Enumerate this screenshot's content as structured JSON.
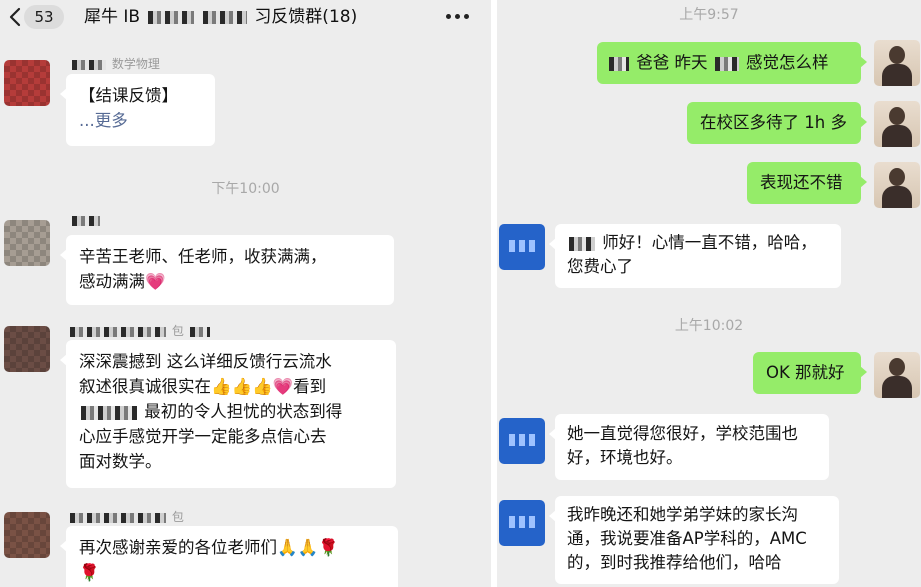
{
  "left_chat": {
    "back_icon": "chevron-left-icon",
    "unread_count": "53",
    "title_start": "犀牛 IB",
    "title_end": "习反馈群(18)",
    "more_icon": "ellipsis-icon",
    "messages": [
      {
        "sender": "数学物理",
        "lines": [
          "【结课反馈】"
        ],
        "more": "...更多"
      },
      {
        "timestamp": "下午10:00"
      },
      {
        "lines": [
          "辛苦王老师、任老师，收获满满，",
          "感动满满💗"
        ]
      },
      {
        "sender": "包",
        "lines": [
          "深深震撼到 这么详细反馈行云流水",
          "叙述很真诚很实在👍👍👍💗看到",
          "最初的令人担忧的状态到得",
          "心应手感觉开学一定能多点信心去",
          "面对数学。"
        ]
      },
      {
        "sender": "包",
        "lines": [
          "再次感谢亲爱的各位老师们🙏🙏🌹",
          "🌹"
        ]
      }
    ]
  },
  "right_chat": {
    "messages": [
      {
        "timestamp": "上午9:57"
      },
      {
        "direction": "out",
        "text_a": "爸爸 昨天",
        "text_b": "感觉怎么样"
      },
      {
        "direction": "out",
        "text": "在校区多待了 1h 多"
      },
      {
        "direction": "out",
        "text": "表现还不错"
      },
      {
        "direction": "in",
        "lines": [
          "师好！心情一直不错，哈哈，",
          "您费心了"
        ]
      },
      {
        "timestamp": "上午10:02"
      },
      {
        "direction": "out",
        "text": "OK 那就好"
      },
      {
        "direction": "in",
        "lines": [
          "她一直觉得您很好，学校范围也",
          "好，环境也好。"
        ]
      },
      {
        "direction": "in",
        "lines": [
          "我昨晚还和她学弟学妹的家长沟",
          "通，我说要准备AP学科的，AMC",
          "的，到时我推荐给他们，哈哈"
        ]
      }
    ]
  }
}
